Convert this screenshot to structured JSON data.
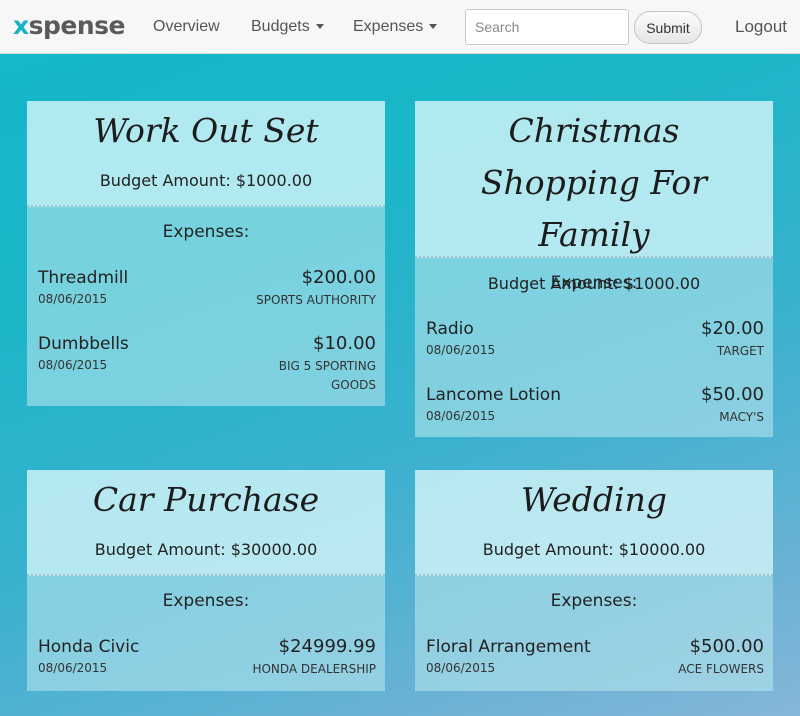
{
  "nav": {
    "brand_first": "x",
    "brand_rest": "spense",
    "overview": "Overview",
    "budgets": "Budgets",
    "expenses": "Expenses",
    "search_placeholder": "Search",
    "submit": "Submit",
    "logout": "Logout"
  },
  "expenses_label": "Expenses:",
  "budgets": [
    {
      "title": "Work Out Set",
      "budget_text": "Budget Amount: $1000.00",
      "expenses": [
        {
          "name": "Threadmill",
          "amount": "$200.00",
          "date": "08/06/2015",
          "vendor": "SPORTS AUTHORITY"
        },
        {
          "name": "Dumbbells",
          "amount": "$10.00",
          "date": "08/06/2015",
          "vendor": "BIG 5 SPORTING GOODS"
        }
      ]
    },
    {
      "title": "Christmas Shopping For Family",
      "budget_text": "Budget Amount: $1000.00",
      "expenses": [
        {
          "name": "Radio",
          "amount": "$20.00",
          "date": "08/06/2015",
          "vendor": "TARGET"
        },
        {
          "name": "Lancome Lotion",
          "amount": "$50.00",
          "date": "08/06/2015",
          "vendor": "MACY'S"
        }
      ]
    },
    {
      "title": "Car Purchase",
      "budget_text": "Budget Amount: $30000.00",
      "expenses": [
        {
          "name": "Honda Civic",
          "amount": "$24999.99",
          "date": "08/06/2015",
          "vendor": "HONDA DEALERSHIP"
        }
      ]
    },
    {
      "title": "Wedding",
      "budget_text": "Budget Amount: $10000.00",
      "expenses": [
        {
          "name": "Floral Arrangement",
          "amount": "$500.00",
          "date": "08/06/2015",
          "vendor": "ACE FLOWERS"
        }
      ]
    }
  ]
}
